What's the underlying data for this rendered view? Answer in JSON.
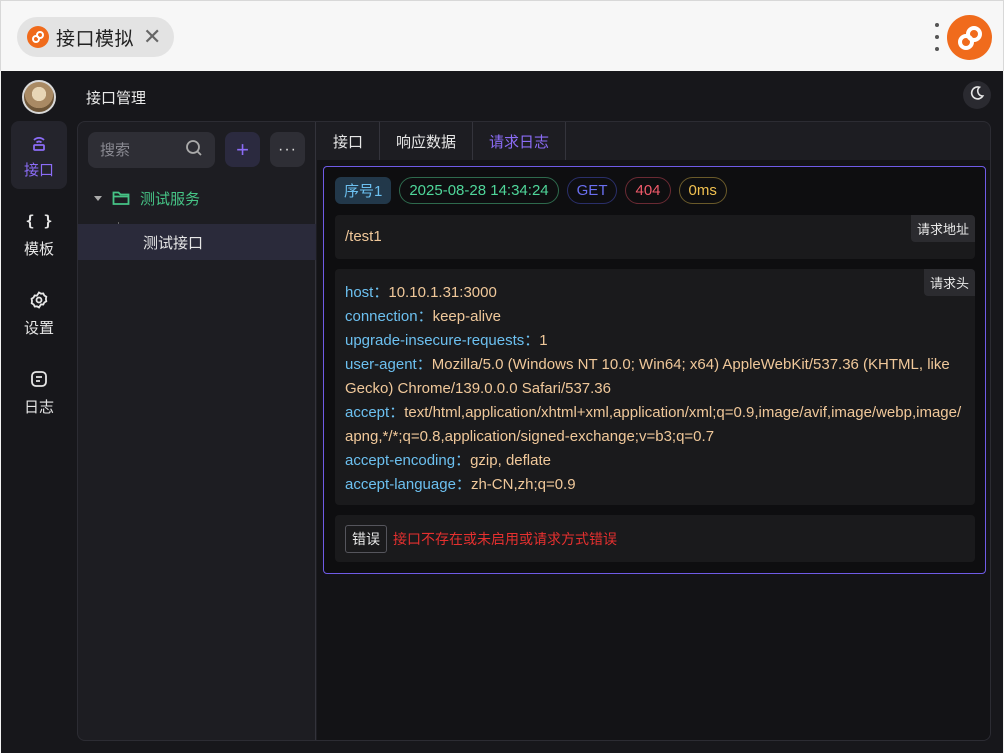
{
  "window": {
    "tab_title": "接口模拟",
    "close_glyph": "✕"
  },
  "header": {
    "section_title": "接口管理"
  },
  "nav": [
    {
      "label": "接口",
      "icon": "broadcast-icon",
      "active": true
    },
    {
      "label": "模板",
      "icon": "braces-icon",
      "active": false
    },
    {
      "label": "设置",
      "icon": "gear-icon",
      "active": false
    },
    {
      "label": "日志",
      "icon": "log-icon",
      "active": false
    }
  ],
  "tree": {
    "search_placeholder": "搜索",
    "add_label": "+",
    "more_label": "···",
    "folder_label": "测试服务",
    "leaf_label": "测试接口"
  },
  "tabs": [
    {
      "label": "接口",
      "active": false
    },
    {
      "label": "响应数据",
      "active": false
    },
    {
      "label": "请求日志",
      "active": true
    }
  ],
  "log": {
    "seq": "序号1",
    "time": "2025-08-28 14:34:24",
    "method": "GET",
    "status": "404",
    "duration": "0ms",
    "url_tag": "请求地址",
    "url": "/test1",
    "headers_tag": "请求头",
    "headers": [
      {
        "key": "host",
        "value": "10.10.1.31:3000"
      },
      {
        "key": "connection",
        "value": "keep-alive"
      },
      {
        "key": "upgrade-insecure-requests",
        "value": "1"
      },
      {
        "key": "user-agent",
        "value": "Mozilla/5.0 (Windows NT 10.0; Win64; x64) AppleWebKit/537.36 (KHTML, like Gecko) Chrome/139.0.0.0 Safari/537.36"
      },
      {
        "key": "accept",
        "value": "text/html,application/xhtml+xml,application/xml;q=0.9,image/avif,image/webp,image/apng,*/*;q=0.8,application/signed-exchange;v=b3;q=0.7"
      },
      {
        "key": "accept-encoding",
        "value": "gzip, deflate"
      },
      {
        "key": "accept-language",
        "value": "zh-CN,zh;q=0.9"
      }
    ],
    "header_sep": "：",
    "error_tag": "错误",
    "error_message": "接口不存在或未启用或请求方式错误"
  },
  "colors": {
    "accent": "#8b6cf6",
    "brand_orange": "#f06b1c",
    "folder_green": "#46c486",
    "error_red": "#e5302f"
  }
}
